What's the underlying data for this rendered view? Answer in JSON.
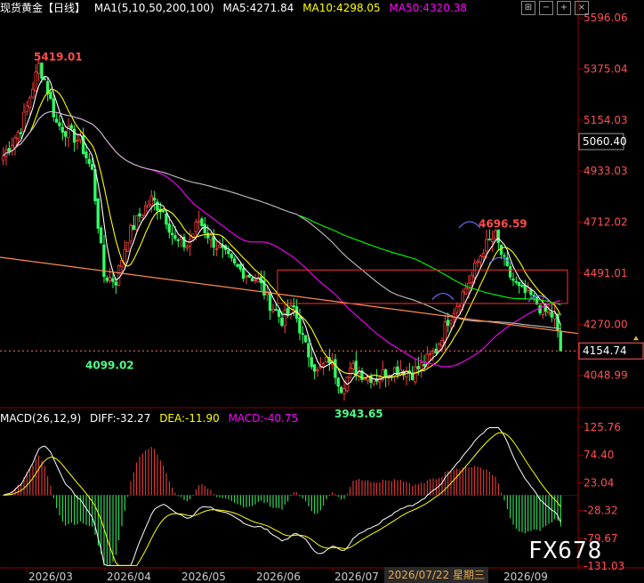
{
  "header": {
    "symbol": "现货黄金【日线】",
    "ma_label": "MA1(5,10,50,200,100)",
    "ma5": "MA5:4271.84",
    "ma10": "MA10:4298.05",
    "ma50": "MA50:4320.38"
  },
  "macd_header": {
    "params": "MACD(26,12,9)",
    "diff": "DIFF:-32.27",
    "dea": "DEA:-11.90",
    "macd": "MACD:-40.75"
  },
  "watermark": "FX678",
  "date_badge": "2026/07/22 星期三",
  "colors": {
    "up": "#ff4040",
    "down": "#33ff66",
    "ma5": "#ffffff",
    "ma10": "#ffff00",
    "ma50": "#ff00ff",
    "ma100": "#c0c0c0",
    "ma200": "#00ff00",
    "trend": "#ff8a50"
  },
  "chart_data": [
    {
      "type": "candlestick",
      "title": "现货黄金【日线】",
      "ylim": [
        3940,
        5596.06
      ],
      "y_ticks": [
        "5596.06",
        "5375.04",
        "5154.03",
        "4933.03",
        "4712.02",
        "4491.01",
        "4270.00",
        "4048.99"
      ],
      "x_ticks": [
        "2026/03",
        "2026/04",
        "2026/05",
        "2026/06",
        "2026/07",
        "2026/09"
      ],
      "annotations": [
        "5419.01",
        "4099.02",
        "3943.65",
        "4696.59"
      ],
      "price_labels": {
        "crosshair": "5060.40",
        "current": "4154.74"
      },
      "waypoints": [
        [
          0,
          5000
        ],
        [
          6,
          5120
        ],
        [
          12,
          5390
        ],
        [
          14,
          5330
        ],
        [
          18,
          5140
        ],
        [
          22,
          5100
        ],
        [
          26,
          5060
        ],
        [
          30,
          4930
        ],
        [
          34,
          4480
        ],
        [
          38,
          4460
        ],
        [
          42,
          4650
        ],
        [
          46,
          4740
        ],
        [
          50,
          4810
        ],
        [
          54,
          4760
        ],
        [
          58,
          4630
        ],
        [
          62,
          4610
        ],
        [
          66,
          4720
        ],
        [
          70,
          4640
        ],
        [
          74,
          4580
        ],
        [
          78,
          4520
        ],
        [
          82,
          4490
        ],
        [
          86,
          4460
        ],
        [
          90,
          4360
        ],
        [
          94,
          4290
        ],
        [
          98,
          4340
        ],
        [
          102,
          4170
        ],
        [
          106,
          4060
        ],
        [
          110,
          4120
        ],
        [
          114,
          4000
        ],
        [
          118,
          4080
        ],
        [
          122,
          4050
        ],
        [
          126,
          4040
        ],
        [
          130,
          4070
        ],
        [
          134,
          4080
        ],
        [
          138,
          4060
        ],
        [
          142,
          4100
        ],
        [
          146,
          4160
        ],
        [
          150,
          4290
        ],
        [
          154,
          4380
        ],
        [
          158,
          4480
        ],
        [
          162,
          4600
        ],
        [
          166,
          4650
        ],
        [
          170,
          4500
        ],
        [
          174,
          4420
        ],
        [
          178,
          4390
        ],
        [
          182,
          4330
        ],
        [
          186,
          4300
        ],
        [
          188,
          4154
        ]
      ],
      "series": [
        {
          "name": "MA5",
          "values": []
        },
        {
          "name": "MA10",
          "values": []
        },
        {
          "name": "MA50",
          "values": []
        }
      ]
    },
    {
      "type": "bar",
      "title": "MACD(26,12,9)",
      "ylim": [
        -130,
        130
      ],
      "y_ticks": [
        "125.76",
        "74.40",
        "23.04",
        "-28.32",
        "-79.67",
        "-131.03"
      ],
      "series": [
        {
          "name": "DIFF",
          "last": -32.27
        },
        {
          "name": "DEA",
          "last": -11.9
        },
        {
          "name": "MACD",
          "last": -40.75
        }
      ]
    }
  ]
}
